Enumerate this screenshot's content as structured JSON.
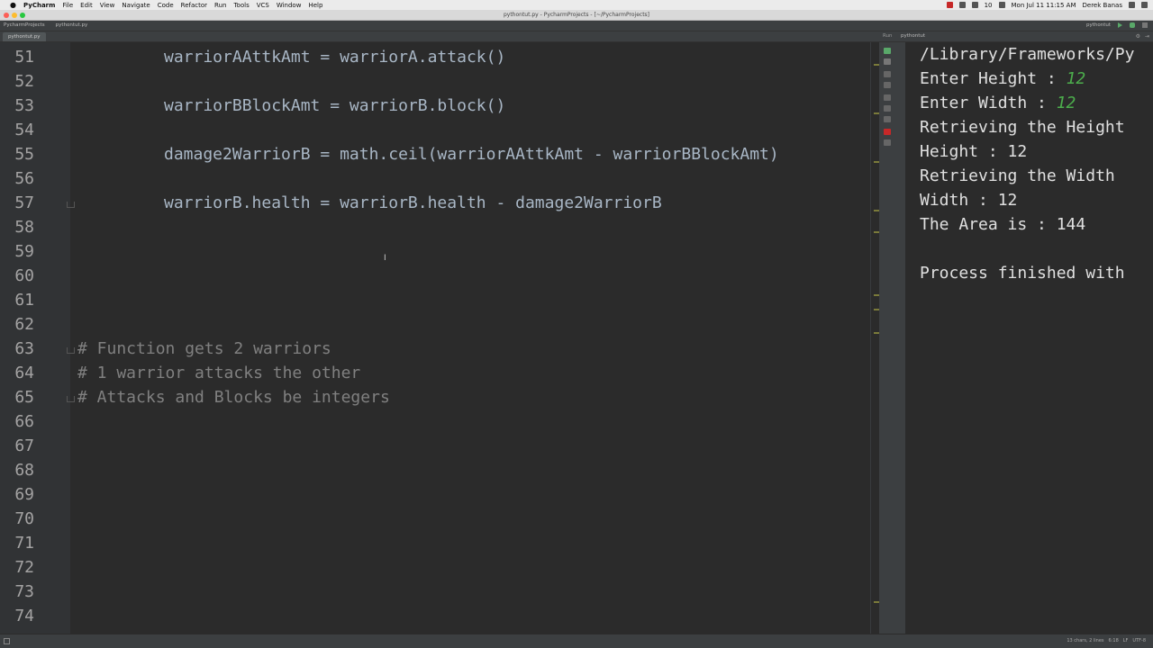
{
  "menubar": {
    "app_name": "PyCharm",
    "menus": [
      "File",
      "Edit",
      "View",
      "Navigate",
      "Code",
      "Refactor",
      "Run",
      "Tools",
      "VCS",
      "Window",
      "Help"
    ],
    "battery": "10",
    "datetime": "Mon Jul 11  11:15 AM",
    "user": "Derek Banas"
  },
  "window": {
    "title": "pythontut.py - PycharmProjects - [~/PycharmProjects]"
  },
  "navbar": {
    "breadcrumbs": [
      "PycharmProjects",
      "pythontut.py"
    ],
    "run_config": "pythontut"
  },
  "editor_tab": {
    "label": "pythontut.py"
  },
  "run_panel": {
    "label": "Run",
    "tab": "pythontut"
  },
  "editor": {
    "lines": [
      {
        "num": "51",
        "text": "warriorAAttkAmt = warriorA.attack()",
        "kind": "code"
      },
      {
        "num": "52",
        "text": "",
        "kind": "blank"
      },
      {
        "num": "53",
        "text": "warriorBBlockAmt = warriorB.block()",
        "kind": "code"
      },
      {
        "num": "54",
        "text": "",
        "kind": "blank"
      },
      {
        "num": "55",
        "text": "damage2WarriorB = math.ceil(warriorAAttkAmt - warriorBBlockAmt)",
        "kind": "code"
      },
      {
        "num": "56",
        "text": "",
        "kind": "blank"
      },
      {
        "num": "57",
        "text": "warriorB.health = warriorB.health - damage2WarriorB",
        "kind": "code"
      },
      {
        "num": "58",
        "text": "",
        "kind": "blank"
      },
      {
        "num": "59",
        "text": "",
        "kind": "blank"
      },
      {
        "num": "60",
        "text": "",
        "kind": "blank"
      },
      {
        "num": "61",
        "text": "",
        "kind": "blank"
      },
      {
        "num": "62",
        "text": "",
        "kind": "blank"
      },
      {
        "num": "63",
        "text": "# Function gets 2 warriors",
        "kind": "comment"
      },
      {
        "num": "64",
        "text": "# 1 warrior attacks the other",
        "kind": "comment"
      },
      {
        "num": "65",
        "text": "# Attacks and Blocks be integers",
        "kind": "comment"
      },
      {
        "num": "66",
        "text": "",
        "kind": "blank"
      },
      {
        "num": "67",
        "text": "",
        "kind": "blank"
      },
      {
        "num": "68",
        "text": "",
        "kind": "blank"
      },
      {
        "num": "69",
        "text": "",
        "kind": "blank"
      },
      {
        "num": "70",
        "text": "",
        "kind": "blank"
      },
      {
        "num": "71",
        "text": "",
        "kind": "blank"
      },
      {
        "num": "72",
        "text": "",
        "kind": "blank"
      },
      {
        "num": "73",
        "text": "",
        "kind": "blank"
      },
      {
        "num": "74",
        "text": "",
        "kind": "blank"
      }
    ]
  },
  "console": {
    "lines": [
      {
        "prompt": "/Library/Frameworks/Py",
        "input": ""
      },
      {
        "prompt": "Enter Height : ",
        "input": "12"
      },
      {
        "prompt": "Enter Width : ",
        "input": "12"
      },
      {
        "prompt": "Retrieving the Height",
        "input": ""
      },
      {
        "prompt": "Height : 12",
        "input": ""
      },
      {
        "prompt": "Retrieving the Width",
        "input": ""
      },
      {
        "prompt": "Width : 12",
        "input": ""
      },
      {
        "prompt": "The Area is : 144",
        "input": ""
      },
      {
        "prompt": "",
        "input": ""
      },
      {
        "prompt": "Process finished with",
        "input": ""
      }
    ]
  },
  "statusbar": {
    "info": [
      "13 chars, 2 lines",
      "6:18",
      "LF",
      "UTF-8"
    ]
  }
}
